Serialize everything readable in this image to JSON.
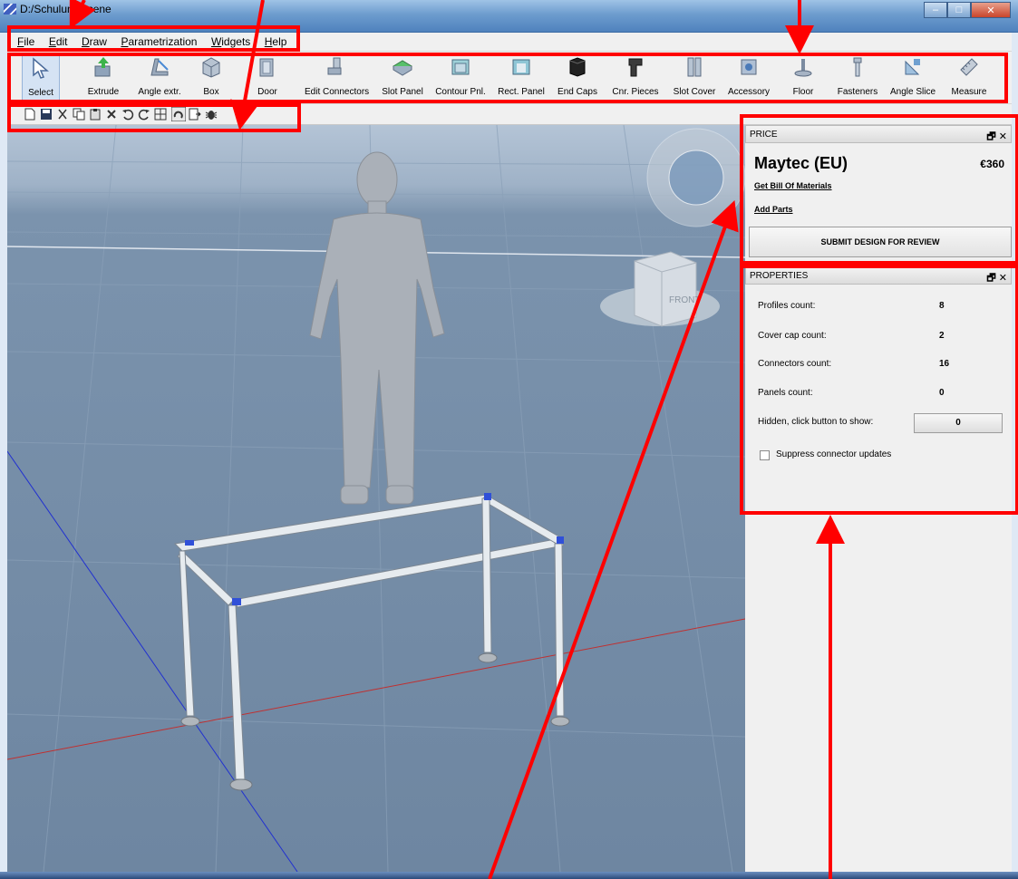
{
  "window": {
    "title": "D:/Schulung.scene",
    "controls": [
      "–",
      "□",
      "✕"
    ]
  },
  "menu": [
    "File",
    "Edit",
    "Draw",
    "Parametrization",
    "Widgets",
    "Help"
  ],
  "toolbar": {
    "tools": [
      {
        "label": "Select",
        "icon": "select-arrow-icon",
        "active": true
      },
      {
        "label": "Extrude",
        "icon": "extrude-icon"
      },
      {
        "label": "Angle extr.",
        "icon": "angle-extrude-icon"
      },
      {
        "label": "Box",
        "icon": "box-icon"
      },
      {
        "label": "Door",
        "icon": "door-icon"
      },
      {
        "label": "Edit Connectors",
        "icon": "edit-connectors-icon"
      },
      {
        "label": "Slot Panel",
        "icon": "slot-panel-icon"
      },
      {
        "label": "Contour Pnl.",
        "icon": "contour-panel-icon"
      },
      {
        "label": "Rect. Panel",
        "icon": "rect-panel-icon"
      },
      {
        "label": "End Caps",
        "icon": "end-caps-icon"
      },
      {
        "label": "Cnr. Pieces",
        "icon": "corner-pieces-icon"
      },
      {
        "label": "Slot Cover",
        "icon": "slot-cover-icon"
      },
      {
        "label": "Accessory",
        "icon": "accessory-icon"
      },
      {
        "label": "Floor",
        "icon": "floor-icon"
      },
      {
        "label": "Fasteners",
        "icon": "fasteners-icon"
      },
      {
        "label": "Angle Slice",
        "icon": "angle-slice-icon"
      },
      {
        "label": "Measure",
        "icon": "measure-icon"
      }
    ]
  },
  "quicktoolbar": [
    "new-file-icon",
    "save-icon",
    "cut-icon",
    "copy-icon",
    "paste-icon",
    "delete-icon",
    "undo-icon",
    "redo-icon",
    "snap-icon",
    "magnet-icon",
    "export-icon",
    "bug-icon"
  ],
  "viewcube": {
    "face_label": "FRONT"
  },
  "price": {
    "header": "PRICE",
    "vendor": "Maytec (EU)",
    "amount": "€360",
    "bom_link": "Get Bill Of Materials",
    "add_parts_link": "Add Parts",
    "submit_label": "SUBMIT DESIGN FOR REVIEW"
  },
  "properties": {
    "header": "PROPERTIES",
    "rows": [
      {
        "label": "Profiles count:",
        "value": "8"
      },
      {
        "label": "Cover cap count:",
        "value": "2"
      },
      {
        "label": "Connectors count:",
        "value": "16"
      },
      {
        "label": "Panels count:",
        "value": "0"
      }
    ],
    "hidden_label": "Hidden, click button to show:",
    "hidden_value": "0",
    "suppress_label": "Suppress connector updates"
  },
  "dock_buttons": "🗗 ✕",
  "colors": {
    "annotation": "#ff0000",
    "viewport": "#7089a4",
    "panel": "#f0f0f0"
  }
}
